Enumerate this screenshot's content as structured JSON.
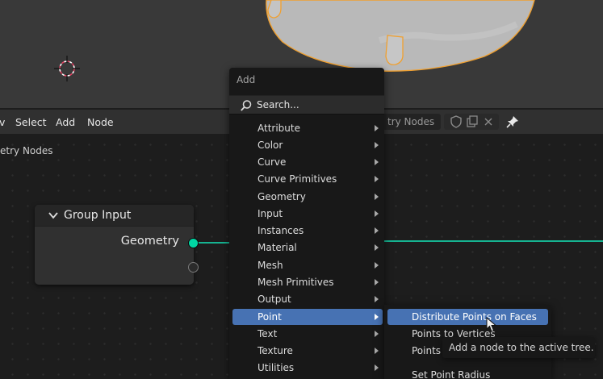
{
  "header": {
    "menus": [
      "View",
      "Select",
      "Add",
      "Node"
    ],
    "menu_visible": [
      "v",
      "Select",
      "Add",
      "Node"
    ],
    "tree_name": "Geometry Nodes",
    "tree_name_visible": "try Nodes"
  },
  "breadcrumb": "Geometry Nodes",
  "breadcrumb_visible": "etry Nodes",
  "node": {
    "title": "Group Input",
    "socket_label": "Geometry"
  },
  "add_menu": {
    "title": "Add",
    "search_label": "Search...",
    "items": [
      "Attribute",
      "Color",
      "Curve",
      "Curve Primitives",
      "Geometry",
      "Input",
      "Instances",
      "Material",
      "Mesh",
      "Mesh Primitives",
      "Output",
      "Point",
      "Text",
      "Texture",
      "Utilities"
    ],
    "active_item": "Point"
  },
  "point_submenu": {
    "items": [
      "Distribute Points on Faces",
      "Points to Vertices",
      "Points",
      "Set Point Radius"
    ],
    "visible": [
      "Distribute Points on Faces",
      "Points to Vertices",
      "Points",
      "Set Point Radius"
    ]
  },
  "tooltip": "Add a node to the active tree.",
  "colors": {
    "accent": "#4772b3",
    "geometry_socket": "#00d6a3",
    "selection_outline": "#f0a030"
  }
}
